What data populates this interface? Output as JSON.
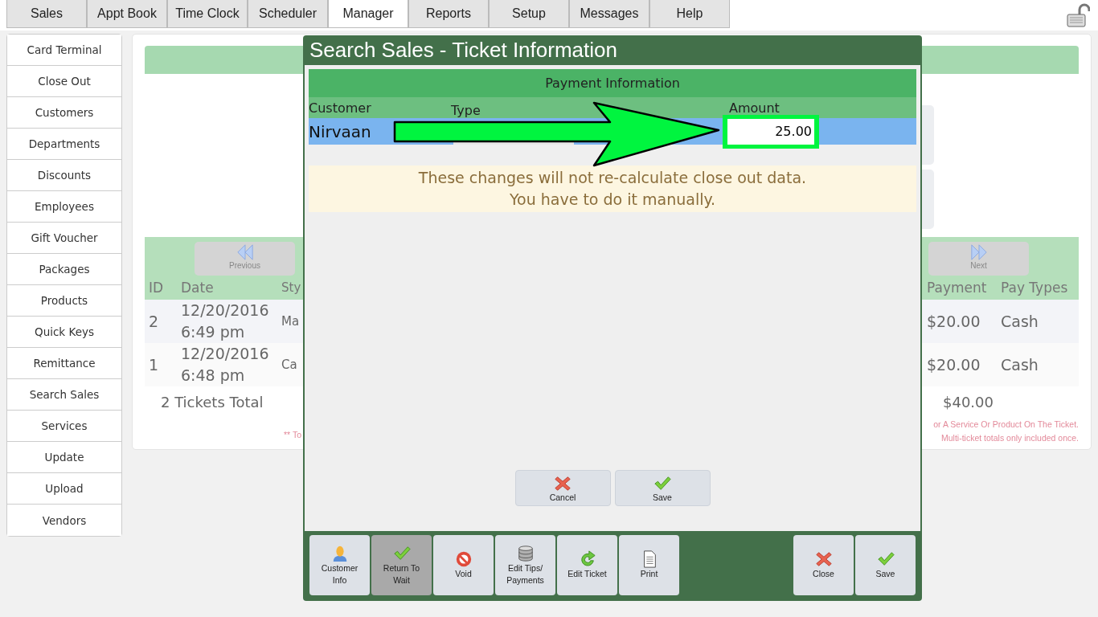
{
  "tabs": [
    {
      "label": "Sales",
      "selected": false
    },
    {
      "label": "Appt Book",
      "selected": false
    },
    {
      "label": "Time Clock",
      "selected": false
    },
    {
      "label": "Scheduler",
      "selected": false
    },
    {
      "label": "Manager",
      "selected": true
    },
    {
      "label": "Reports",
      "selected": false
    },
    {
      "label": "Setup",
      "selected": false
    },
    {
      "label": "Messages",
      "selected": false
    },
    {
      "label": "Help",
      "selected": false
    }
  ],
  "sidebar": {
    "items": [
      "Card Terminal",
      "Close Out",
      "Customers",
      "Departments",
      "Discounts",
      "Employees",
      "Gift Voucher",
      "Packages",
      "Products",
      "Quick Keys",
      "Remittance",
      "Search Sales",
      "Services",
      "Update",
      "Upload",
      "Vendors"
    ]
  },
  "sales_table": {
    "previous": "Previous",
    "next": "Next",
    "columns": [
      "ID",
      "Date",
      "Sty",
      "Payment",
      "Pay Types"
    ],
    "rows": [
      {
        "id": "2",
        "date": "12/20/2016",
        "time": "6:49 pm",
        "column_3": "Ma",
        "payment": "$20.00",
        "pay_types": "Cash"
      },
      {
        "id": "1",
        "date": "12/20/2016",
        "time": "6:48 pm",
        "column_3": "Ca",
        "payment": "$20.00",
        "pay_types": "Cash"
      }
    ],
    "total_label": "2 Tickets Total",
    "total_payment": "$40.00",
    "notes_left": "** To",
    "notes_right": [
      "or A Service Or Product On The Ticket.",
      "Multi-ticket totals only included once."
    ]
  },
  "dialog": {
    "title": "Search Sales - Ticket Information",
    "payment_header": "Payment Information",
    "columns": [
      "Customer",
      "Type",
      "Amount"
    ],
    "payment_row": {
      "customer": "Nirvaan",
      "amount": "25.00"
    },
    "notice": [
      "These changes will not re-calculate close out data.",
      "You have to do it manually."
    ],
    "actions": [
      {
        "label": "Cancel",
        "kind": "cancel"
      },
      {
        "label": "Save",
        "kind": "save"
      }
    ],
    "footer_left": [
      {
        "label": "Customer Info",
        "kind": "person",
        "selected": false
      },
      {
        "label": "Return To Wait",
        "kind": "check",
        "selected": true
      },
      {
        "label": "Void",
        "kind": "void",
        "selected": false
      },
      {
        "label": "Edit Tips/ Payments",
        "kind": "database",
        "selected": false
      },
      {
        "label": "Edit Ticket",
        "kind": "refresh",
        "selected": false
      },
      {
        "label": "Print",
        "kind": "document",
        "selected": false
      }
    ],
    "footer_right": [
      {
        "label": "Close",
        "kind": "cancel",
        "selected": false
      },
      {
        "label": "Save",
        "kind": "check",
        "selected": false
      }
    ]
  }
}
